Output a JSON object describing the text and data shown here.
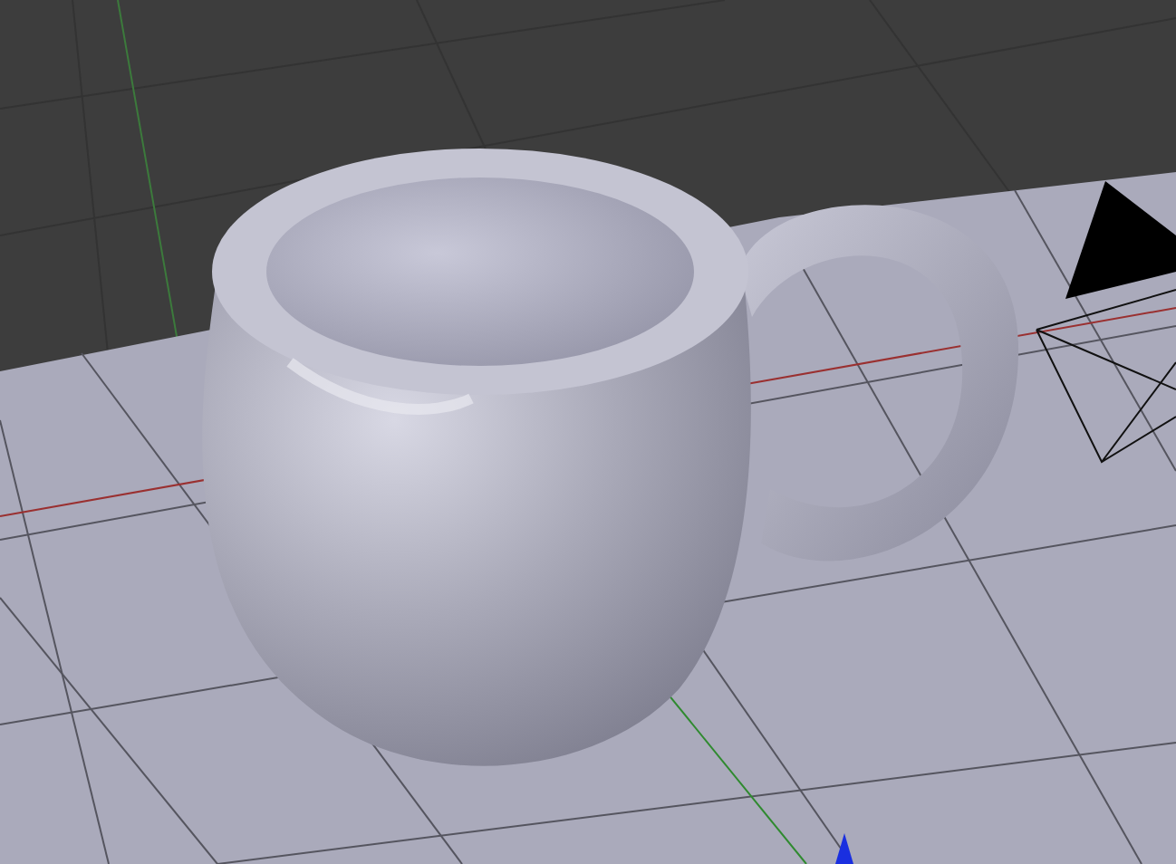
{
  "viewport": {
    "kind": "scene"
  }
}
